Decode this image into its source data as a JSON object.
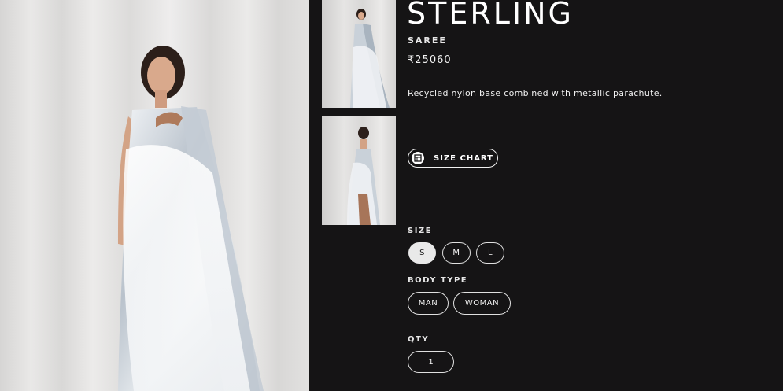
{
  "product": {
    "title": "STERLING",
    "category": "SAREE",
    "price": "₹25060",
    "description": "Recycled nylon base combined with metallic parachute."
  },
  "size_chart": {
    "label": "SIZE CHART",
    "icon": "size-chart-icon"
  },
  "size": {
    "label": "SIZE",
    "options": [
      "S",
      "M",
      "L"
    ],
    "selected": "S"
  },
  "body_type": {
    "label": "BODY TYPE",
    "options": [
      "MAN",
      "WOMAN"
    ]
  },
  "qty": {
    "label": "QTY",
    "value": "1"
  },
  "colors": {
    "background": "#151415",
    "text": "#ffffff",
    "selected_pill": "#e9e9e9"
  }
}
